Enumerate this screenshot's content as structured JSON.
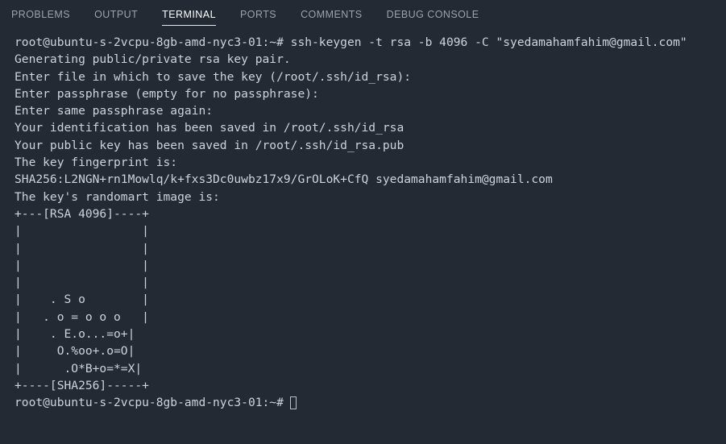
{
  "panel": {
    "tabs": [
      {
        "label": "PROBLEMS",
        "active": false
      },
      {
        "label": "OUTPUT",
        "active": false
      },
      {
        "label": "TERMINAL",
        "active": true
      },
      {
        "label": "PORTS",
        "active": false
      },
      {
        "label": "COMMENTS",
        "active": false
      },
      {
        "label": "DEBUG CONSOLE",
        "active": false
      }
    ]
  },
  "colors": {
    "background": "#242a33",
    "text": "#ccd3de",
    "tab_inactive": "#9aa2ae",
    "tab_active": "#ffffff",
    "tab_underline": "#e7e7e7",
    "cursor": "#b9c0cc"
  },
  "terminal": {
    "prompt": "root@ubuntu-s-2vcpu-8gb-amd-nyc3-01:~#",
    "command": "ssh-keygen -t rsa -b 4096 -C \"syedamahamfahim@gmail.com\"",
    "lines": [
      "root@ubuntu-s-2vcpu-8gb-amd-nyc3-01:~# ssh-keygen -t rsa -b 4096 -C \"syedamahamfahim@gmail.com\"",
      "Generating public/private rsa key pair.",
      "Enter file in which to save the key (/root/.ssh/id_rsa):",
      "Enter passphrase (empty for no passphrase):",
      "Enter same passphrase again:",
      "Your identification has been saved in /root/.ssh/id_rsa",
      "Your public key has been saved in /root/.ssh/id_rsa.pub",
      "The key fingerprint is:",
      "SHA256:L2NGN+rn1Mowlq/k+fxs3Dc0uwbz17x9/GrOLoK+CfQ syedamahamfahim@gmail.com",
      "The key's randomart image is:",
      "+---[RSA 4096]----+",
      "|                 |",
      "|                 |",
      "|                 |",
      "|                 |",
      "|    . S o        |",
      "|   . o = o o o   |",
      "|    . E.o...=o+|",
      "|     O.%oo+.o=O|",
      "|      .O*B+o=*=X|",
      "+----[SHA256]-----+"
    ],
    "final_prompt": "root@ubuntu-s-2vcpu-8gb-amd-nyc3-01:~#",
    "cursor": "block-outline-cursor"
  }
}
